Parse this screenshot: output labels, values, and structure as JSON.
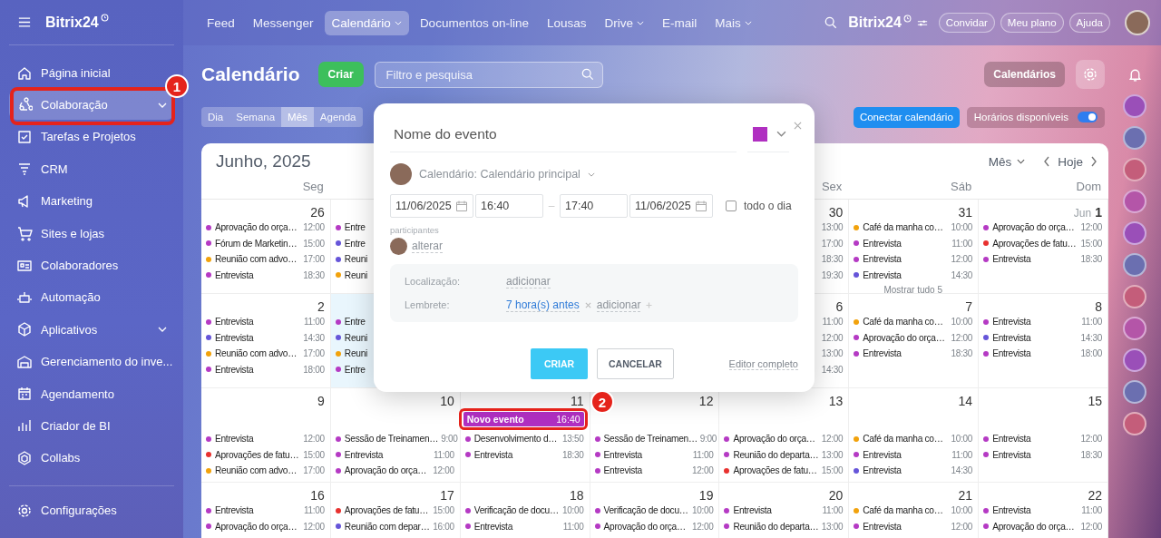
{
  "sidebar": {
    "logo": "Bitrix24",
    "items": [
      {
        "label": "Página inicial",
        "selected": false,
        "submenu": false
      },
      {
        "label": "Colaboração",
        "selected": true,
        "submenu": true
      },
      {
        "label": "Tarefas e Projetos",
        "selected": false,
        "submenu": false
      },
      {
        "label": "CRM",
        "selected": false,
        "submenu": false
      },
      {
        "label": "Marketing",
        "selected": false,
        "submenu": false
      },
      {
        "label": "Sites e lojas",
        "selected": false,
        "submenu": false
      },
      {
        "label": "Colaboradores",
        "selected": false,
        "submenu": false
      },
      {
        "label": "Automação",
        "selected": false,
        "submenu": false
      },
      {
        "label": "Aplicativos",
        "selected": false,
        "submenu": true
      },
      {
        "label": "Gerenciamento do inve...",
        "selected": false,
        "submenu": false
      },
      {
        "label": "Agendamento",
        "selected": false,
        "submenu": false
      },
      {
        "label": "Criador de BI",
        "selected": false,
        "submenu": false
      },
      {
        "label": "Collabs",
        "selected": false,
        "submenu": false
      }
    ],
    "settings": "Configurações"
  },
  "topbar": {
    "nav": [
      {
        "label": "Feed",
        "selected": false,
        "dropdown": false
      },
      {
        "label": "Messenger",
        "selected": false,
        "dropdown": false
      },
      {
        "label": "Calendário",
        "selected": true,
        "dropdown": true
      },
      {
        "label": "Documentos on-line",
        "selected": false,
        "dropdown": false
      },
      {
        "label": "Lousas",
        "selected": false,
        "dropdown": false
      },
      {
        "label": "Drive",
        "selected": false,
        "dropdown": true
      },
      {
        "label": "E-mail",
        "selected": false,
        "dropdown": false
      },
      {
        "label": "Mais",
        "selected": false,
        "dropdown": true
      }
    ],
    "brand": "Bitrix24",
    "buttons": [
      "Convidar",
      "Meu plano",
      "Ajuda"
    ]
  },
  "toolbar": {
    "title": "Calendário",
    "create": "Criar",
    "search_placeholder": "Filtro e pesquisa",
    "calendars": "Calendários",
    "views": [
      {
        "label": "Dia",
        "selected": false
      },
      {
        "label": "Semana",
        "selected": false
      },
      {
        "label": "Mês",
        "selected": true
      },
      {
        "label": "Agenda",
        "selected": false
      }
    ],
    "connect": "Conectar calendário",
    "availability": {
      "label": "Horários disponíveis",
      "on": true
    }
  },
  "calendar": {
    "title": "Junho, 2025",
    "mode": "Mês",
    "today": "Hoje",
    "weekdays": {
      "monday": "Seg",
      "friday": "Sex",
      "saturday": "Sáb",
      "sunday": "Dom"
    },
    "weeks": [
      {
        "cells": [
          {
            "date": "26",
            "today": false,
            "events": [
              {
                "title": "Aprovação do orça…",
                "time": "12:00",
                "color": "#b53ac4"
              },
              {
                "title": "Fórum de Marketin…",
                "time": "15:00",
                "color": "#b53ac4"
              },
              {
                "title": "Reunião com advo…",
                "time": "17:00",
                "color": "#f2a20c"
              },
              {
                "title": "Entrevista",
                "time": "18:30",
                "color": "#b53ac4"
              }
            ]
          },
          {
            "today": false,
            "events": [
              {
                "title": "Entre",
                "color": "#b53ac4"
              },
              {
                "title": "Entre",
                "color": "#6655d9"
              },
              {
                "title": "Reuni",
                "color": "#6655d9"
              },
              {
                "title": "Reuni",
                "color": "#f2a20c"
              }
            ]
          },
          {},
          {},
          {
            "date": "30",
            "today": false,
            "events": [
              {
                "time": "13:00"
              },
              {
                "time": "17:00"
              },
              {
                "time": "18:30"
              },
              {
                "time": "19:30"
              }
            ]
          },
          {
            "date": "31",
            "today": false,
            "events": [
              {
                "title": "Café da manha co…",
                "time": "10:00",
                "color": "#f2a20c"
              },
              {
                "title": "Entrevista",
                "time": "11:00",
                "color": "#b53ac4"
              },
              {
                "title": "Entrevista",
                "time": "12:00",
                "color": "#b53ac4"
              },
              {
                "title": "Entrevista",
                "time": "14:30",
                "color": "#6655d9"
              }
            ],
            "more": "Mostrar tudo 5"
          },
          {
            "month": "Jun",
            "date": "1",
            "today": false,
            "events": [
              {
                "title": "Aprovação do orça…",
                "time": "12:00",
                "color": "#b53ac4"
              },
              {
                "title": "Aprovações de fatu…",
                "time": "15:00",
                "color": "#e8312f"
              },
              {
                "title": "Entrevista",
                "time": "18:30",
                "color": "#b53ac4"
              }
            ]
          }
        ]
      },
      {
        "cells": [
          {
            "date": "2",
            "today": false,
            "events": [
              {
                "title": "Entrevista",
                "time": "11:00",
                "color": "#b53ac4"
              },
              {
                "title": "Entrevista",
                "time": "14:30",
                "color": "#6655d9"
              },
              {
                "title": "Reunião com advo…",
                "time": "17:00",
                "color": "#f2a20c"
              },
              {
                "title": "Entrevista",
                "time": "18:00",
                "color": "#b53ac4"
              }
            ]
          },
          {
            "today": true,
            "events": [
              {
                "title": "Entre",
                "color": "#b53ac4"
              },
              {
                "title": "Reuni",
                "color": "#6655d9"
              },
              {
                "title": "Reuni",
                "color": "#f2a20c"
              },
              {
                "title": "Entre",
                "color": "#b53ac4"
              }
            ]
          },
          {},
          {},
          {
            "date": "6",
            "today": false,
            "events": [
              {
                "time": "11:00"
              },
              {
                "time": "12:00"
              },
              {
                "time": "13:00"
              },
              {
                "time": "14:30"
              }
            ]
          },
          {
            "date": "7",
            "today": false,
            "events": [
              {
                "title": "Café da manha co…",
                "time": "10:00",
                "color": "#f2a20c"
              },
              {
                "title": "Aprovação do orça…",
                "time": "12:00",
                "color": "#b53ac4"
              },
              {
                "title": "Entrevista",
                "time": "18:30",
                "color": "#b53ac4"
              }
            ]
          },
          {
            "date": "8",
            "today": false,
            "events": [
              {
                "title": "Entrevista",
                "time": "11:00",
                "color": "#b53ac4"
              },
              {
                "title": "Entrevista",
                "time": "14:30",
                "color": "#6655d9"
              },
              {
                "title": "Entrevista",
                "time": "18:00",
                "color": "#b53ac4"
              }
            ]
          }
        ]
      },
      {
        "cells": [
          {
            "date": "9",
            "today": false,
            "events": [
              {
                "title": "Entrevista",
                "time": "12:00",
                "color": "#b53ac4"
              },
              {
                "title": "Aprovações de fatu…",
                "time": "15:00",
                "color": "#e8312f"
              },
              {
                "title": "Reunião com advo…",
                "time": "17:00",
                "color": "#f2a20c"
              }
            ]
          },
          {
            "date": "10",
            "today": false,
            "events": [
              {
                "title": "Sessão de Treinamen…",
                "time": "9:00",
                "color": "#b53ac4"
              },
              {
                "title": "Entrevista",
                "time": "11:00",
                "color": "#b53ac4"
              },
              {
                "title": "Aprovação do orça…",
                "time": "12:00",
                "color": "#b53ac4"
              }
            ]
          },
          {
            "date": "11",
            "today": false,
            "new_event": {
              "title": "Novo evento",
              "time": "16:40",
              "color": "#b02fc1"
            },
            "events": [
              {
                "title": "Desenvolvimento d…",
                "time": "13:50",
                "color": "#b53ac4"
              },
              {
                "title": "Entrevista",
                "time": "18:30",
                "color": "#b53ac4"
              }
            ]
          },
          {
            "date": "12",
            "today": false,
            "events": [
              {
                "title": "Sessão de Treinamen…",
                "time": "9:00",
                "color": "#b53ac4"
              },
              {
                "title": "Entrevista",
                "time": "11:00",
                "color": "#b53ac4"
              },
              {
                "title": "Entrevista",
                "time": "12:00",
                "color": "#b53ac4"
              }
            ]
          },
          {
            "date": "13",
            "today": false,
            "events": [
              {
                "title": "Aprovação do orça…",
                "time": "12:00",
                "color": "#b53ac4"
              },
              {
                "title": "Reunião do departa…",
                "time": "13:00",
                "color": "#b53ac4"
              },
              {
                "title": "Aprovações de fatu…",
                "time": "15:00",
                "color": "#e8312f"
              }
            ]
          },
          {
            "date": "14",
            "today": false,
            "events": [
              {
                "title": "Café da manha co…",
                "time": "10:00",
                "color": "#f2a20c"
              },
              {
                "title": "Entrevista",
                "time": "11:00",
                "color": "#b53ac4"
              },
              {
                "title": "Entrevista",
                "time": "14:30",
                "color": "#6655d9"
              }
            ]
          },
          {
            "date": "15",
            "today": false,
            "events": [
              {
                "title": "Entrevista",
                "time": "12:00",
                "color": "#b53ac4"
              },
              {
                "title": "Entrevista",
                "time": "18:30",
                "color": "#b53ac4"
              }
            ]
          }
        ]
      },
      {
        "cells": [
          {
            "date": "16",
            "today": false,
            "events": [
              {
                "title": "Entrevista",
                "time": "11:00",
                "color": "#b53ac4"
              },
              {
                "title": "Aprovação do orça…",
                "time": "12:00",
                "color": "#b53ac4"
              }
            ]
          },
          {
            "date": "17",
            "today": false,
            "events": [
              {
                "title": "Aprovações de fatu…",
                "time": "15:00",
                "color": "#e8312f"
              },
              {
                "title": "Reunião com depar…",
                "time": "16:00",
                "color": "#6655d9"
              }
            ]
          },
          {
            "date": "18",
            "today": false,
            "events": [
              {
                "title": "Verificação de docu…",
                "time": "10:00",
                "color": "#b53ac4"
              },
              {
                "title": "Entrevista",
                "time": "11:00",
                "color": "#b53ac4"
              }
            ]
          },
          {
            "date": "19",
            "today": false,
            "events": [
              {
                "title": "Verificação de docu…",
                "time": "10:00",
                "color": "#b53ac4"
              },
              {
                "title": "Aprovação do orça…",
                "time": "12:00",
                "color": "#b53ac4"
              }
            ]
          },
          {
            "date": "20",
            "today": false,
            "events": [
              {
                "title": "Entrevista",
                "time": "11:00",
                "color": "#b53ac4"
              },
              {
                "title": "Reunião do departa…",
                "time": "13:00",
                "color": "#b53ac4"
              }
            ]
          },
          {
            "date": "21",
            "today": false,
            "events": [
              {
                "title": "Café da manha co…",
                "time": "10:00",
                "color": "#f2a20c"
              },
              {
                "title": "Entrevista",
                "time": "12:00",
                "color": "#b53ac4"
              }
            ]
          },
          {
            "date": "22",
            "today": false,
            "events": [
              {
                "title": "Entrevista",
                "time": "11:00",
                "color": "#b53ac4"
              },
              {
                "title": "Aprovação do orça…",
                "time": "12:00",
                "color": "#b53ac4"
              }
            ]
          }
        ]
      }
    ]
  },
  "dialog": {
    "name_placeholder": "Nome do evento",
    "color": "#b02fc1",
    "calendar": "Calendário: Calendário principal",
    "start_date": "11/06/2025",
    "start_time": "16:40",
    "separator": "–",
    "end_time": "17:40",
    "end_date": "11/06/2025",
    "all_day": {
      "label": "todo o dia",
      "checked": false
    },
    "participants_label": "participantes",
    "participants_action": "alterar",
    "location_label": "Localização:",
    "location_action": "adicionar",
    "reminder_label": "Lembrete:",
    "reminder": "7 hora(s) antes",
    "reminder_action": "adicionar",
    "create": "CRIAR",
    "cancel": "CANCELAR",
    "full_editor": "Editor completo"
  },
  "annotations": [
    {
      "label": "1"
    },
    {
      "label": "2"
    }
  ]
}
